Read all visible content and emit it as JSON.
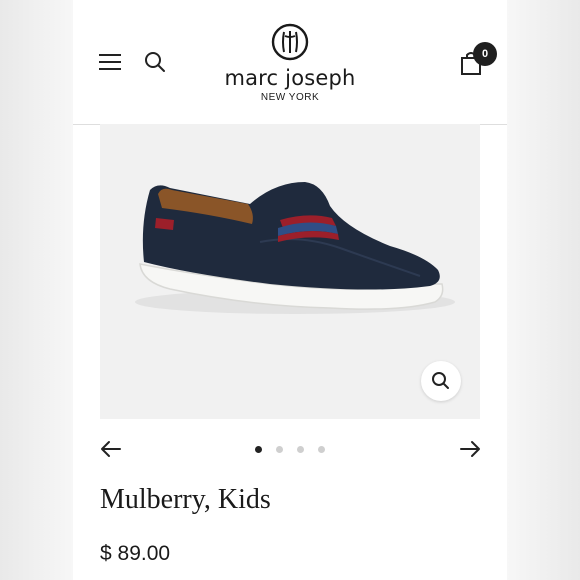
{
  "brand": {
    "name": "marc joseph",
    "subtitle": "NEW YORK"
  },
  "header": {
    "menu_icon": "hamburger-menu-icon",
    "search_icon": "search-icon",
    "cart_icon": "shopping-bag-icon",
    "cart_count": "0"
  },
  "gallery": {
    "zoom_icon": "magnifier-zoom-icon",
    "prev_icon": "arrow-left-icon",
    "next_icon": "arrow-right-icon",
    "slide_count": 4,
    "active_slide": 1
  },
  "product": {
    "title": "Mulberry, Kids",
    "price": "$ 89.00"
  },
  "colors": {
    "text": "#1a1a1a",
    "shoe_leather": "#1f2a3d",
    "stripe_red": "#9c1f2a",
    "stripe_blue": "#2f4e86",
    "sole": "#f4f4f2"
  }
}
